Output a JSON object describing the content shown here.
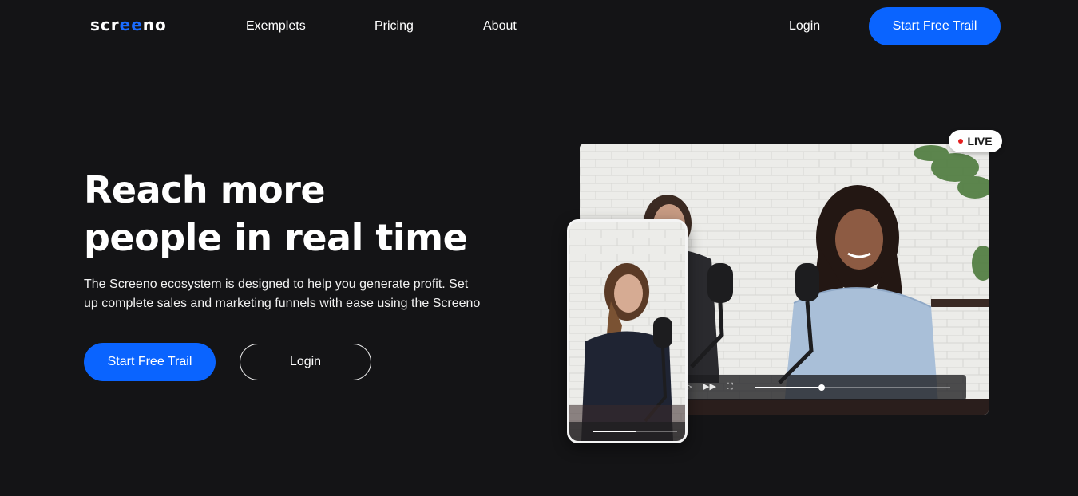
{
  "brand": {
    "logo_parts": [
      "scr",
      "ee",
      "no"
    ],
    "accent_color": "#0a64ff"
  },
  "nav": {
    "links": [
      "Exemplets",
      "Pricing",
      "About"
    ],
    "login": "Login",
    "cta": "Start Free Trail"
  },
  "hero": {
    "title_line1": "Reach more",
    "title_line2": "people in real time",
    "description": "The Screeno ecosystem is designed to help you generate profit. Set up complete sales and marketing funnels with ease using the Screeno",
    "primary_button": "Start Free Trail",
    "secondary_button": "Login"
  },
  "media": {
    "live_label": "LIVE",
    "video_progress": 0.34,
    "phone_progress": 0.5,
    "icons": [
      "play-icon",
      "fast-forward-icon",
      "fullscreen-icon"
    ]
  }
}
